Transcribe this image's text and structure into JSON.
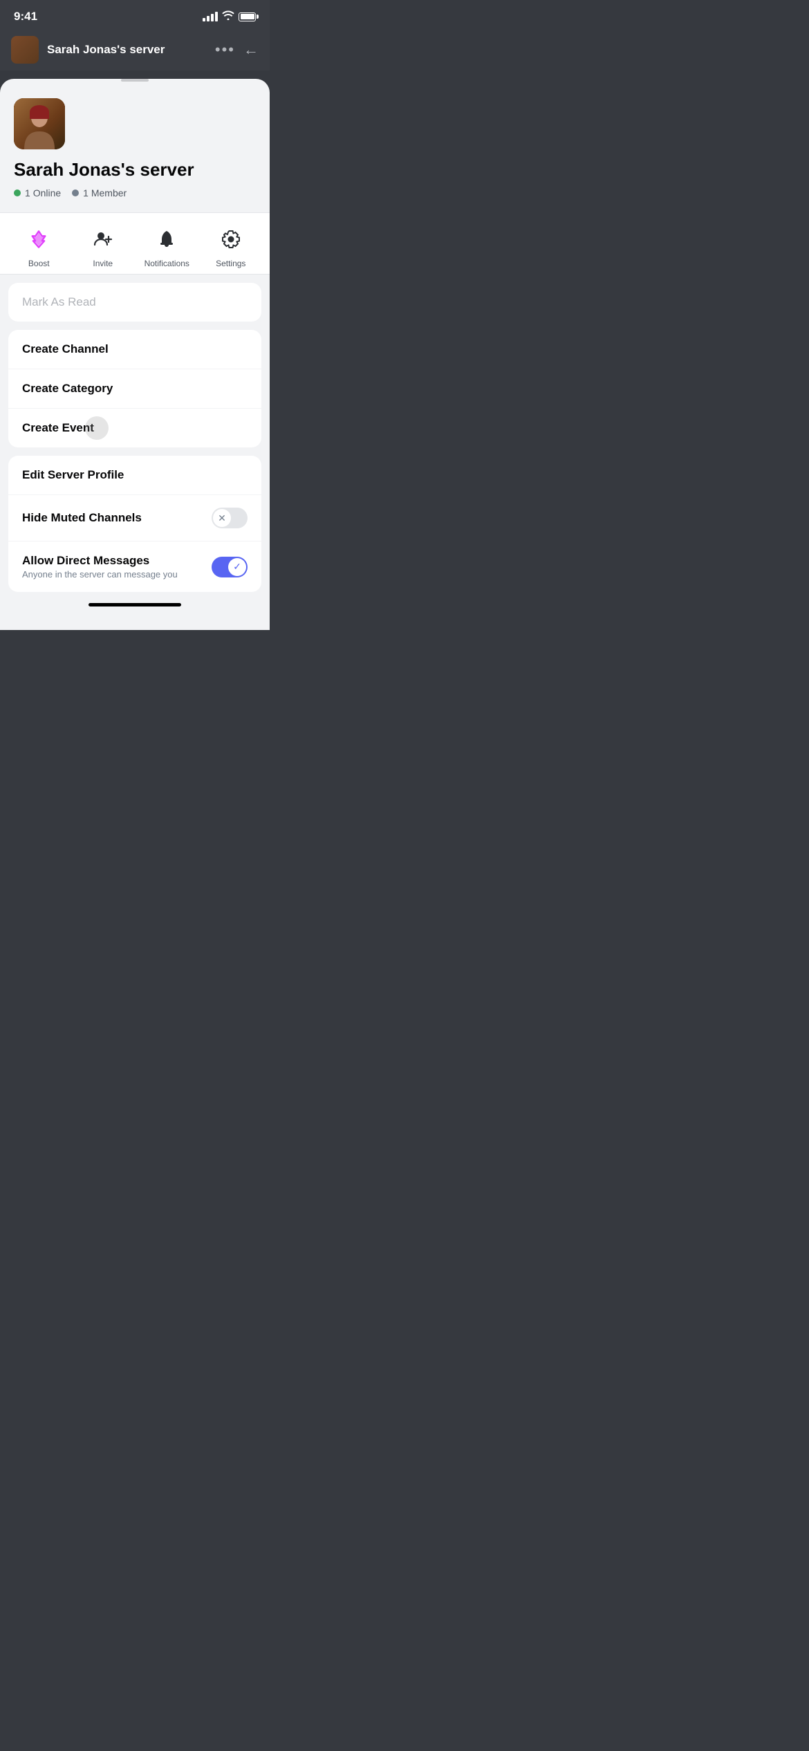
{
  "statusBar": {
    "time": "9:41",
    "battery": "full"
  },
  "topHeader": {
    "serverName": "Sarah Jonas's server",
    "moreLabel": "•••",
    "backLabel": "←"
  },
  "sheet": {
    "dragHandle": true,
    "serverName": "Sarah Jonas's server",
    "stats": {
      "online": {
        "count": "1",
        "label": "Online"
      },
      "member": {
        "count": "1",
        "label": "Member"
      }
    },
    "actions": [
      {
        "id": "boost",
        "label": "Boost"
      },
      {
        "id": "invite",
        "label": "Invite"
      },
      {
        "id": "notifications",
        "label": "Notifications"
      },
      {
        "id": "settings",
        "label": "Settings"
      }
    ],
    "markAsRead": "Mark As Read",
    "menuGroup1": [
      {
        "id": "create-channel",
        "label": "Create Channel",
        "sublabel": null
      },
      {
        "id": "create-category",
        "label": "Create Category",
        "sublabel": null
      },
      {
        "id": "create-event",
        "label": "Create Event",
        "sublabel": null
      }
    ],
    "menuGroup2": [
      {
        "id": "edit-server-profile",
        "label": "Edit Server Profile",
        "sublabel": null,
        "toggle": null
      },
      {
        "id": "hide-muted-channels",
        "label": "Hide Muted Channels",
        "sublabel": null,
        "toggle": "off"
      },
      {
        "id": "allow-direct-messages",
        "label": "Allow Direct Messages",
        "sublabel": "Anyone in the server can message you",
        "toggle": "on"
      }
    ]
  }
}
